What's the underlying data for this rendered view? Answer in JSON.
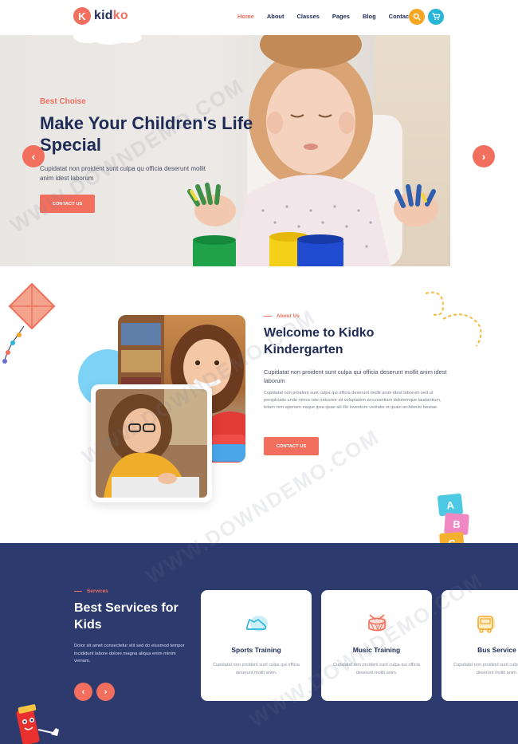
{
  "logo": {
    "mark": "K",
    "text_a": "kid",
    "text_b": "ko"
  },
  "nav": {
    "items": [
      "Home",
      "About",
      "Classes",
      "Pages",
      "Blog",
      "Contact"
    ],
    "active": "Home"
  },
  "icons": {
    "search": "search-icon",
    "cart": "cart-icon"
  },
  "hero": {
    "kicker": "Best Choise",
    "title": "Make Your Children's Life Special",
    "text": "Cupidatat non proident sunt culpa qu officia deserunt mollit anim idest laborum",
    "button": "CONTACT US",
    "prev": "‹",
    "next": "›"
  },
  "about": {
    "kicker": "About Us",
    "title": "Welcome to Kidko Kindergarten",
    "lead": "Cupidatat non proident sunt culpa qui officia deserunt mollit anim idest laborum",
    "body": "Cupidatat non proident sunt culpa qui officia deserunt mollit anim idest laborum sed ut perspiciatis unde omnis iste natusnor sit voluptatem accusantium doloremque laudantium, totam rem aperiam eaque ipsa quae ab illo inventore veritatis et quasi architecto beatae.",
    "button": "CONTACT US",
    "blocks": [
      "A",
      "B",
      "C"
    ]
  },
  "services": {
    "kicker": "Services",
    "title": "Best Services for Kids",
    "text": "Dolor sit amet consectetur elit sed do eiusmod tempor incididunt labore dolore magna aliqua enim minim veniam.",
    "prev": "‹",
    "next": "›",
    "cards": [
      {
        "title": "Sports Training",
        "text": "Cupidatat non proident sunt culpa qui officia deserunt mollit anim.",
        "icon": "shoe-icon"
      },
      {
        "title": "Music Training",
        "text": "Cupidatat non proident sunt culpa qui officia deserunt mollit anim.",
        "icon": "drum-icon"
      },
      {
        "title": "Bus Service",
        "text": "Cupidatat non proident sunt culpa qui officia deserunt mollit anim.",
        "icon": "bus-icon"
      }
    ]
  },
  "colors": {
    "accent": "#f26f5e",
    "navy": "#2c3a6e",
    "title": "#1f2a55",
    "yellow": "#f5a623",
    "cyan": "#27b5d8"
  },
  "watermark": "WWW.DOWNDEMO.COM"
}
